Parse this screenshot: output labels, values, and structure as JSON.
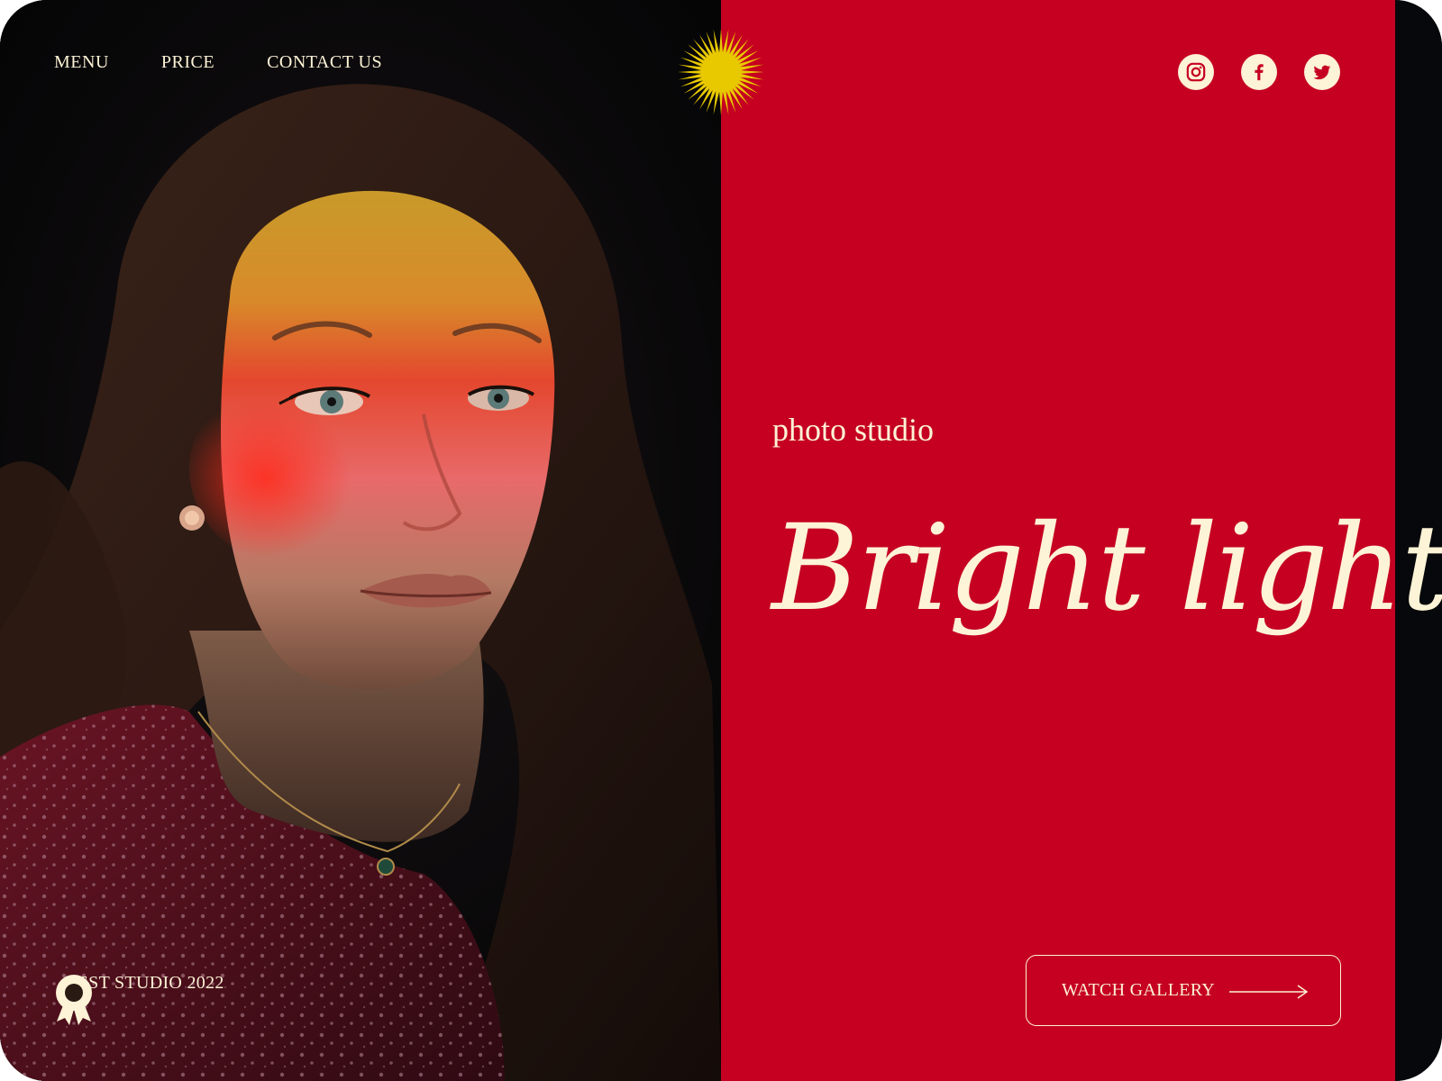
{
  "nav": {
    "items": [
      {
        "label": "MENU"
      },
      {
        "label": "PRICE"
      },
      {
        "label": "CONTACT US"
      }
    ]
  },
  "logo": {
    "icon": "sun-burst-icon",
    "color": "#e8c900"
  },
  "social": [
    {
      "icon": "instagram-icon"
    },
    {
      "icon": "facebook-icon"
    },
    {
      "icon": "twitter-icon"
    }
  ],
  "hero": {
    "subtitle": "photo studio",
    "title": "Bright light",
    "cta_label": "WATCH GALLERY"
  },
  "award": {
    "icon": "award-ribbon-icon",
    "label": "BEST STUDIO 2022"
  },
  "colors": {
    "accent_red": "#c50021",
    "cream": "#fdf3d6",
    "dark": "#07080b",
    "sun_yellow": "#e8c900"
  }
}
